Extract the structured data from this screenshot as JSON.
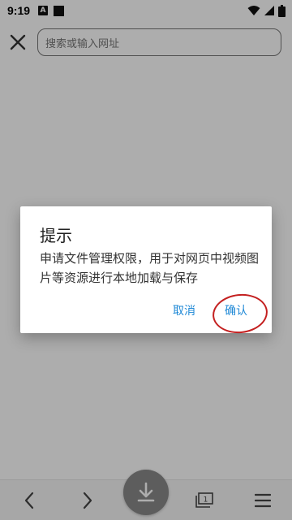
{
  "status_bar": {
    "time": "9:19",
    "notification_icon_letter": "A",
    "icons": [
      "a-icon",
      "square-icon",
      "wifi-icon",
      "signal-icon",
      "battery-icon"
    ]
  },
  "top_bar": {
    "close_icon": "close-icon",
    "search_placeholder": "搜索或输入网址"
  },
  "dialog": {
    "title": "提示",
    "message": "申请文件管理权限，用于对网页中视频图片等资源进行本地加载与保存",
    "cancel_label": "取消",
    "confirm_label": "确认",
    "button_color": "#1e88d6"
  },
  "bottom_bar": {
    "items": [
      "back-icon",
      "forward-icon",
      "download-icon",
      "tabs-icon",
      "menu-icon"
    ],
    "tab_count": "1"
  },
  "colors": {
    "scrim": "rgba(0,0,0,0.32)",
    "fab": "#8a8a8a",
    "annotation": "#c42020"
  }
}
